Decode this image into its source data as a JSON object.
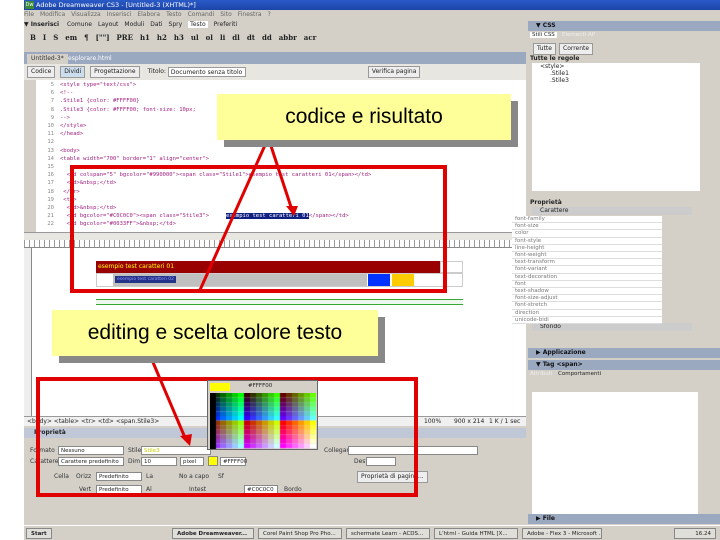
{
  "window": {
    "title": "Adobe Dreamweaver CS3 - [Untitled-3 (XHTML)*]",
    "controls": [
      "_",
      "□",
      "×"
    ]
  },
  "menu": [
    "File",
    "Modifica",
    "Visualizza",
    "Inserisci",
    "Elabora",
    "Testo",
    "Comandi",
    "Sito",
    "Finestra",
    "?"
  ],
  "insert_bar": {
    "title": "▼ Inserisci",
    "tabs": [
      "Comune",
      "Layout",
      "Moduli",
      "Dati",
      "Spry",
      "Testo",
      "Preferiti"
    ]
  },
  "text_toolbar": [
    "B",
    "I",
    "S",
    "em",
    "¶",
    "[\"\"]",
    "PRE",
    "h1",
    "h2",
    "h3",
    "ul",
    "ol",
    "li",
    "dl",
    "dt",
    "dd",
    "abbr",
    "acr"
  ],
  "doc_tabs": [
    "Untitled-3*",
    "esplorare.html"
  ],
  "doc_toolbar": {
    "code": "Codice",
    "split": "Dividi",
    "design": "Progettazione",
    "title_label": "Titolo:",
    "title_value": "Documento senza titolo",
    "validate": "Verifica pagina"
  },
  "code_lines": [
    {
      "n": "5",
      "t": "<style type=\"text/css\">"
    },
    {
      "n": "6",
      "t": "<!--"
    },
    {
      "n": "7",
      "t": ".Stile1 {color: #FFFF00}"
    },
    {
      "n": "8",
      "t": ".Stile3 {color: #FFFF00; font-size: 10px;"
    },
    {
      "n": "9",
      "t": "-->"
    },
    {
      "n": "10",
      "t": "</style>"
    },
    {
      "n": "11",
      "t": "</head>"
    },
    {
      "n": "12",
      "t": ""
    },
    {
      "n": "13",
      "t": "<body>"
    },
    {
      "n": "14",
      "t": "<table width=\"700\" border=\"1\" align=\"center\">"
    },
    {
      "n": "15",
      "t": ""
    },
    {
      "n": "16",
      "t": "  <td colspan=\"5\" bgcolor=\"#990000\"><span class=\"Stile1\">esempio test caratteri 01</span></td>"
    },
    {
      "n": "17",
      "t": "  <td>&nbsp;</td>"
    },
    {
      "n": "18",
      "t": " </tr>"
    },
    {
      "n": "19",
      "t": " <tr>"
    },
    {
      "n": "20",
      "t": "  <td>&nbsp;</td>"
    },
    {
      "n": "21",
      "t": "  <td bgcolor=\"#C0C0C0\"><span class=\"Stile3\">"
    },
    {
      "n": "22",
      "t": "  <td bgcolor=\"#0033FF\">&nbsp;</td>"
    }
  ],
  "code_selected": "esempio test caratteri 01",
  "code_after_selected": "</span></td>",
  "design": {
    "row1_text": "esempio test caratteri 01",
    "row2_text": "esempio test caratteri 02"
  },
  "colors": {
    "dark_red": "#990000",
    "gray": "#C0C0C0",
    "blue": "#0033FF",
    "orange": "#FFCC00",
    "yellow": "#FFFF00",
    "annotation_red": "#E00000",
    "callout": "#FFFF99"
  },
  "tag_selector": "<body> <table> <tr> <td> <span.Stile3>",
  "status": {
    "zoom": "100%",
    "size": "900 x 214",
    "weight": "1 K / 1 sec"
  },
  "color_picker": {
    "value": "#FFFF00"
  },
  "properties": {
    "title": "Proprietà",
    "format_label": "Formato",
    "format_value": "Nessuno",
    "style_label": "Stile",
    "style_value": "Stile3",
    "font_label": "Carattere",
    "font_value": "Carattere predefinito",
    "size_label": "Dim",
    "size_value": "10",
    "unit_value": "pixel",
    "color_value": "#FFFF00",
    "link_label": "Collegam",
    "target_label": "Dest.",
    "cell_label": "Cella",
    "horz_label": "Orizz",
    "horz_value": "Predefinito",
    "vert_label": "Vert",
    "vert_value": "Predefinito",
    "w_label": "La",
    "h_label": "Al",
    "nowrap_label": "No a capo",
    "header_label": "Intest",
    "bg_label": "Sf",
    "bg_value": "#C0C0C0",
    "border_label": "Bordo",
    "page_props": "Proprietà di pagina..."
  },
  "css_panel": {
    "title": "▼ CSS",
    "tabs": [
      "Stili CSS",
      "Elementi AP"
    ],
    "modes": [
      "Tutte",
      "Corrente"
    ],
    "rules_header": "Tutte le regole",
    "rules": [
      "<style>",
      ".Stile1",
      ".Stile3"
    ],
    "props_header": "Proprietà",
    "category": "Carattere",
    "properties": [
      "font-family",
      "font-size",
      "color",
      "font-style",
      "line-height",
      "font-weight",
      "text-transform",
      "font-variant",
      "text-decoration",
      "font",
      "text-shadow",
      "font-size-adjust",
      "font-stretch",
      "direction",
      "unicode-bidi"
    ],
    "category2": "Sfondo"
  },
  "panels": {
    "applicazione": "▶ Applicazione",
    "tag": "▼ Tag <span>",
    "tag_tabs": [
      "Attributi",
      "Comportamenti"
    ],
    "file": "▶ File"
  },
  "taskbar": {
    "start": "Start",
    "tasks": [
      "Adobe Dreamweaver...",
      "Corel Paint Shop Pro Pho...",
      "schermate Learn - ACDS...",
      "L'html - Guida HTML [X...",
      "Adobe - Flex 3 - Microsoft ..."
    ],
    "clock": "16.24"
  },
  "annotations": {
    "callout1": "codice  e risultato",
    "callout2": "editing e scelta colore testo"
  }
}
